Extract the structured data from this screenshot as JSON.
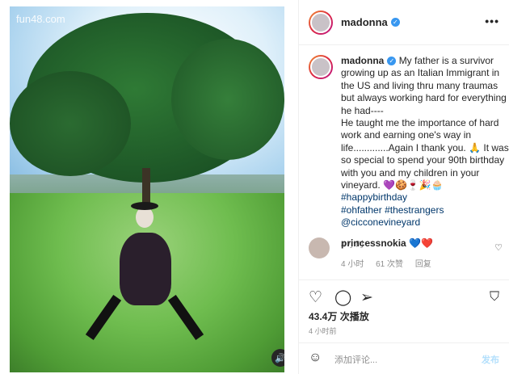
{
  "watermark": "fun48.com",
  "post": {
    "username": "madonna",
    "verified_icon": "verified-badge-icon",
    "more_icon": "more-options-icon",
    "caption_lines": [
      "My father is a survivor",
      "growing up as an Italian Immigrant in",
      "the US and living thru many traumas",
      "but always working hard for",
      "everything he had----",
      "He taught me the importance of hard",
      "work and earning one's way in",
      "life.............Again I thank you. 🙏 It was",
      "so special to spend your 90th birthday",
      "with you and my children in your",
      "vineyard. 💜🍪🍷🎉🧁 "
    ],
    "hashtags_inline": "#happybirthday",
    "hashtags": [
      "#ohfather",
      "#thestrangers"
    ],
    "mention": "@cicconevineyard",
    "caption_time": "4 小时"
  },
  "comment": {
    "username": "princessnokia",
    "emoji": "💙❤️",
    "time": "4 小时",
    "likes": "61 次赞",
    "reply": "回复"
  },
  "actions": {
    "like_icon": "heart-icon",
    "comment_icon": "comment-icon",
    "share_icon": "share-icon",
    "save_icon": "bookmark-icon"
  },
  "views": "43.4万 次播放",
  "post_time": "4 小时前",
  "add_comment": {
    "placeholder": "添加评论...",
    "post_label": "发布"
  },
  "colors": {
    "link": "#00376b",
    "verified": "#3897f0",
    "post_disabled": "#b2dffc"
  }
}
